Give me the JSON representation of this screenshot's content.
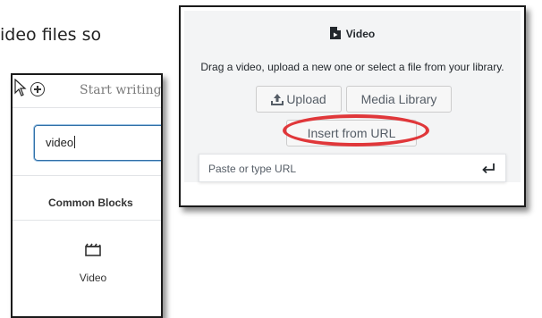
{
  "background": {
    "article_fragment": "ideo files so"
  },
  "inserter": {
    "placeholder": "Start writing",
    "search_value": "video",
    "section_title": "Common Blocks",
    "block_label": "Video",
    "icons": {
      "cursor": "mouse-pointer-icon",
      "add": "add-block-icon",
      "block": "video-block-icon"
    }
  },
  "video_block": {
    "title": "Video",
    "instructions": "Drag a video, upload a new one or select a file from your library.",
    "upload_label": "Upload",
    "media_library_label": "Media Library",
    "insert_from_url_label": "Insert from URL",
    "url_placeholder": "Paste or type URL",
    "icons": {
      "title": "video-file-icon",
      "upload": "upload-icon",
      "submit": "return-arrow-icon"
    },
    "highlight_color": "#e0373a"
  }
}
